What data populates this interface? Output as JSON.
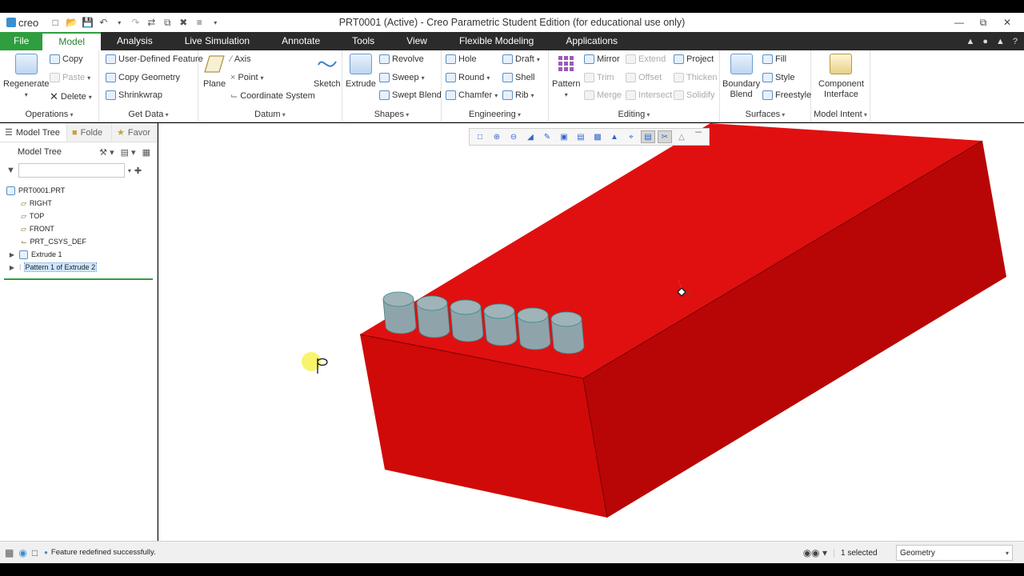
{
  "window": {
    "app_logo": "creo",
    "title": "PRT0001 (Active) - Creo Parametric Student Edition (for educational use only)"
  },
  "menu": {
    "tabs": [
      "File",
      "Model",
      "Analysis",
      "Live Simulation",
      "Annotate",
      "Tools",
      "View",
      "Flexible Modeling",
      "Applications"
    ],
    "active": "Model"
  },
  "ribbon": {
    "operations": {
      "label": "Operations",
      "regenerate": "Regenerate",
      "copy": "Copy",
      "paste": "Paste",
      "delete": "Delete"
    },
    "get_data": {
      "label": "Get Data",
      "udf": "User-Defined Feature",
      "copy_geometry": "Copy Geometry",
      "shrinkwrap": "Shrinkwrap"
    },
    "datum": {
      "label": "Datum",
      "plane": "Plane",
      "axis": "Axis",
      "point": "Point",
      "csys": "Coordinate System",
      "sketch": "Sketch"
    },
    "shapes": {
      "label": "Shapes",
      "extrude": "Extrude",
      "revolve": "Revolve",
      "sweep": "Sweep",
      "swept_blend": "Swept Blend"
    },
    "engineering": {
      "label": "Engineering",
      "hole": "Hole",
      "round": "Round",
      "chamfer": "Chamfer",
      "draft": "Draft",
      "shell": "Shell",
      "rib": "Rib"
    },
    "editing": {
      "label": "Editing",
      "pattern": "Pattern",
      "mirror": "Mirror",
      "trim": "Trim",
      "merge": "Merge",
      "extend": "Extend",
      "offset": "Offset",
      "intersect": "Intersect",
      "project": "Project",
      "thicken": "Thicken",
      "solidify": "Solidify"
    },
    "surfaces": {
      "label": "Surfaces",
      "boundary_blend_1": "Boundary",
      "boundary_blend_2": "Blend",
      "fill": "Fill",
      "style": "Style",
      "freestyle": "Freestyle"
    },
    "model_intent": {
      "label": "Model Intent",
      "component_1": "Component",
      "component_2": "Interface"
    }
  },
  "sidebar": {
    "tabs": [
      "Model Tree",
      "Folde",
      "Favor"
    ],
    "header": "Model Tree",
    "filter_placeholder": "",
    "tree": [
      {
        "label": "PRT0001.PRT",
        "icon": "part-icon",
        "expandable": false
      },
      {
        "label": "RIGHT",
        "icon": "datum-plane-icon",
        "expandable": false
      },
      {
        "label": "TOP",
        "icon": "datum-plane-icon",
        "expandable": false
      },
      {
        "label": "FRONT",
        "icon": "datum-plane-icon",
        "expandable": false
      },
      {
        "label": "PRT_CSYS_DEF",
        "icon": "csys-icon",
        "expandable": false
      },
      {
        "label": "Extrude 1",
        "icon": "extrude-icon",
        "expandable": true
      },
      {
        "label": "Pattern 1 of Extrude 2",
        "icon": "pattern-icon",
        "expandable": true,
        "selected": true
      }
    ]
  },
  "viewport": {
    "model_color": "#e01010",
    "pin_color": "#9fb3b8",
    "pin_count": 6
  },
  "status": {
    "message": "Feature redefined successfully.",
    "selection": "1 selected",
    "filter": "Geometry"
  }
}
